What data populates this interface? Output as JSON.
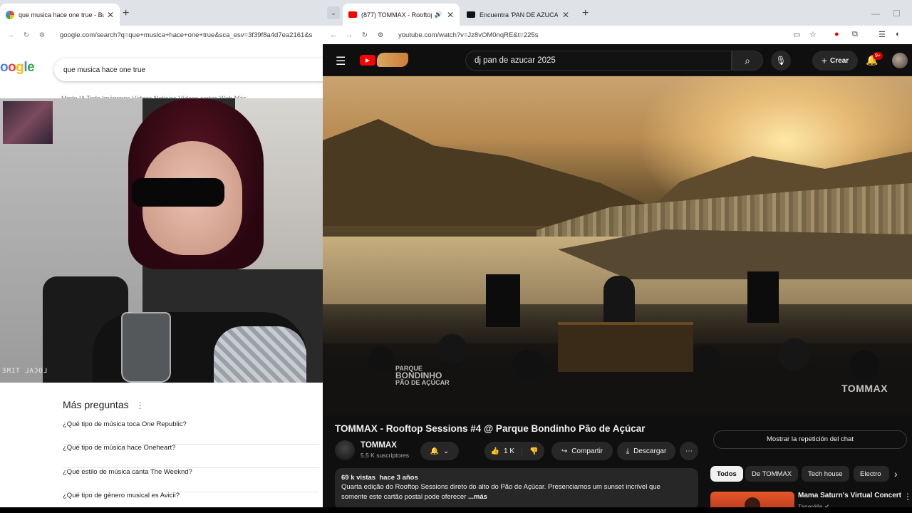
{
  "left_browser": {
    "tab": {
      "title": "que musica hace one true - Bu"
    },
    "url": "google.com/search?q=que+musica+hace+one+true&sca_esv=3f39f8a4d7ea2161&s",
    "logo": "Google",
    "search_query": "que musica hace one true",
    "filters_text": "Modo IA   Todo   Imágenes   Vídeos   Noticias   Vídeos cortos   Web   Más",
    "webcam_stamp": "LOCAL TIME",
    "paa": {
      "title": "Más preguntas",
      "items": [
        "¿Qué tipo de música toca One Republic?",
        "¿Qué tipo de música hace Oneheart?",
        "¿Qué estilo de música canta The Weeknd?",
        "¿Qué tipo de género musical es Avicii?"
      ]
    }
  },
  "right_browser": {
    "tabs": [
      {
        "title": "(877) TOMMAX - Rooftop S",
        "active": true,
        "icon": "youtube-icon"
      },
      {
        "title": "Encuentra 'PAN DE AZUCAR DJ",
        "active": false,
        "icon": "tiktok-icon"
      }
    ],
    "url": "youtube.com/watch?v=Jz8vOM0nqRE&t=225s",
    "search_query": "dj pan de azucar 2025",
    "create_label": "Crear",
    "notif_count": "9+",
    "video": {
      "title": "TOMMAX - Rooftop Sessions #4 @ Parque Bondinho Pão de Açúcar",
      "watermark_left_small": "PARQUE",
      "watermark_left_big": "BONDINHO",
      "watermark_left_sub": "PÃO DE AÇÚCAR",
      "watermark_right": "TOMMAX"
    },
    "channel": {
      "name": "TOMMAX",
      "subs": "5.5 K suscriptores"
    },
    "actions": {
      "likes": "1 K",
      "share": "Compartir",
      "download": "Descargar"
    },
    "description": {
      "views": "69 k vistas",
      "age": "hace 3 años",
      "line1": "Quarta edição do Rooftop Sessions direto do alto do Pão de Açúcar. Presenciamos um sunset incrível que",
      "line2": "somente este cartão postal pode oferecer",
      "more": "...más"
    },
    "chat_button": "Mostrar la repetición del chat",
    "chips": [
      "Todos",
      "De TOMMAX",
      "Tech house",
      "Electro"
    ],
    "recommendation": {
      "title": "Mama Saturn's Virtual Concert",
      "channel": "Tanerélle"
    }
  },
  "colors": {
    "youtube_red": "#ff0000",
    "yt_bg": "#0f0f0f",
    "chip_bg": "#272727"
  }
}
